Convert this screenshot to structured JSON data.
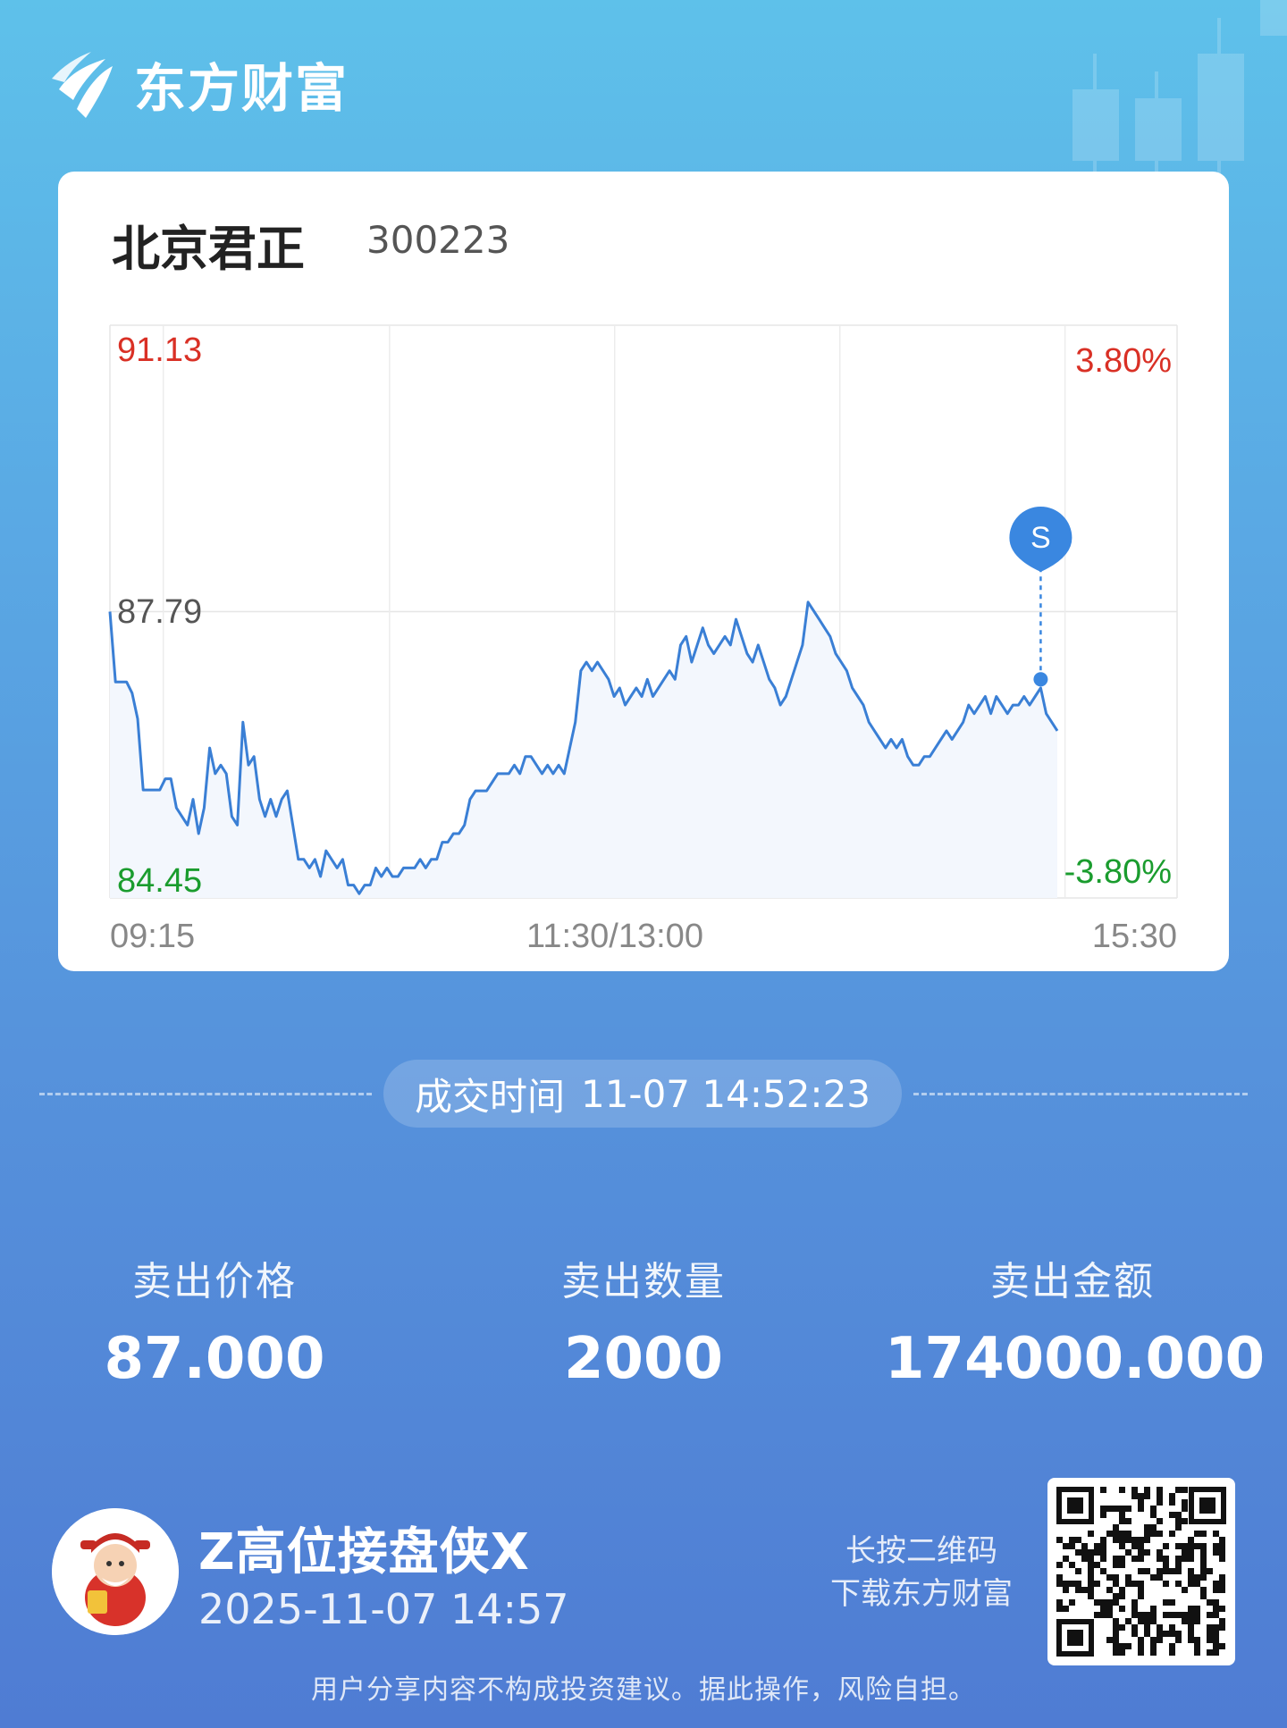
{
  "brand": {
    "name": "东方财富",
    "logo_icon": "eastmoney-logo-icon"
  },
  "stock": {
    "name": "北京君正",
    "code": "300223"
  },
  "chart_data": {
    "type": "line",
    "title": "",
    "x_ticks": [
      "09:15",
      "11:30/13:00",
      "15:30"
    ],
    "y_left_ticks": [
      "91.13",
      "87.79",
      "84.45"
    ],
    "y_right_ticks": [
      "3.80%",
      "-3.80%"
    ],
    "ylim": [
      84.45,
      91.13
    ],
    "reference_price": 87.79,
    "series": [
      {
        "values": [
          87.79,
          86.97,
          86.97,
          86.97,
          86.84,
          86.54,
          85.71,
          85.71,
          85.71,
          85.71,
          85.84,
          85.84,
          85.5,
          85.4,
          85.3,
          85.6,
          85.2,
          85.5,
          86.2,
          85.9,
          86.0,
          85.9,
          85.4,
          85.3,
          86.5,
          86.0,
          86.1,
          85.6,
          85.4,
          85.6,
          85.4,
          85.6,
          85.7,
          85.3,
          84.9,
          84.9,
          84.8,
          84.9,
          84.7,
          85.0,
          84.9,
          84.8,
          84.9,
          84.6,
          84.6,
          84.5,
          84.6,
          84.6,
          84.8,
          84.7,
          84.8,
          84.7,
          84.7,
          84.8,
          84.8,
          84.8,
          84.9,
          84.8,
          84.9,
          84.9,
          85.1,
          85.1,
          85.2,
          85.2,
          85.3,
          85.6,
          85.7,
          85.7,
          85.7,
          85.8,
          85.9,
          85.9,
          85.9,
          86.0,
          85.9,
          86.1,
          86.1,
          86.0,
          85.9,
          86.0,
          85.9,
          86.0,
          85.9,
          86.2,
          86.5,
          87.1,
          87.2,
          87.1,
          87.2,
          87.1,
          87.0,
          86.8,
          86.9,
          86.7,
          86.8,
          86.9,
          86.8,
          87.0,
          86.8,
          86.9,
          87.0,
          87.1,
          87.0,
          87.4,
          87.5,
          87.2,
          87.4,
          87.6,
          87.4,
          87.3,
          87.4,
          87.5,
          87.4,
          87.7,
          87.5,
          87.3,
          87.2,
          87.4,
          87.2,
          87.0,
          86.9,
          86.7,
          86.8,
          87.0,
          87.2,
          87.4,
          87.9,
          87.8,
          87.7,
          87.6,
          87.5,
          87.3,
          87.2,
          87.1,
          86.9,
          86.8,
          86.7,
          86.5,
          86.4,
          86.3,
          86.2,
          86.3,
          86.2,
          86.3,
          86.1,
          86.0,
          86.0,
          86.1,
          86.1,
          86.2,
          86.3,
          86.4,
          86.3,
          86.4,
          86.5,
          86.7,
          86.6,
          86.7,
          86.8,
          86.6,
          86.8,
          86.7,
          86.6,
          86.7,
          86.7,
          86.8,
          86.7,
          86.8,
          86.9,
          86.6,
          86.5,
          86.4
        ],
        "marker": {
          "label": "S",
          "price": 87.0,
          "time": "14:52"
        }
      }
    ],
    "grid": true
  },
  "trade_time": {
    "label": "成交时间",
    "value": "11-07 14:52:23"
  },
  "stats": [
    {
      "label": "卖出价格",
      "value": "87.000"
    },
    {
      "label": "卖出数量",
      "value": "2000"
    },
    {
      "label": "卖出金额",
      "value": "174000.000"
    }
  ],
  "user": {
    "name": "Z高位接盘侠X",
    "post_time": "2025-11-07 14:57",
    "avatar_icon": "fortune-god-avatar-icon"
  },
  "qr": {
    "hint_line1": "长按二维码",
    "hint_line2": "下载东方财富",
    "icon": "qr-code-icon"
  },
  "disclaimer": "用户分享内容不构成投资建议。据此操作，风险自担。",
  "colors": {
    "up": "#d93025",
    "down": "#1a9c2e",
    "line": "#3a7fd5",
    "marker": "#3a87e0"
  }
}
